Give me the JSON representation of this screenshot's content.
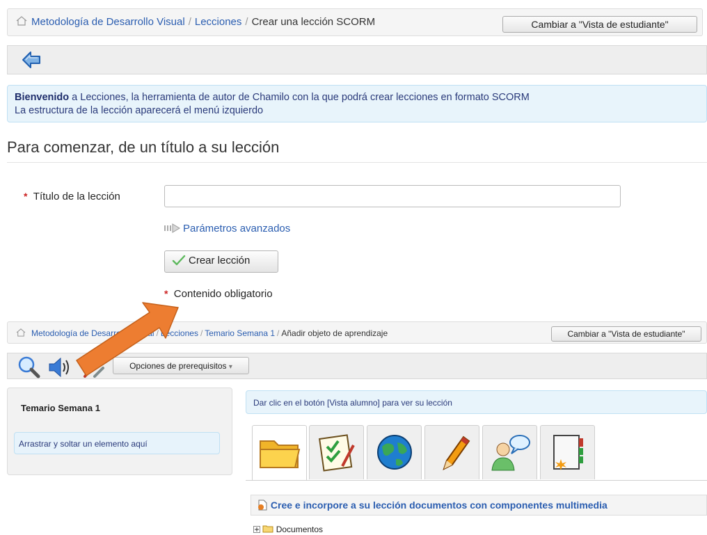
{
  "top": {
    "breadcrumb": [
      "Metodología de Desarrollo Visual",
      "Lecciones",
      "Crear una lección SCORM"
    ],
    "switch_view_label": "Cambiar a \"Vista de estudiante\""
  },
  "welcome": {
    "bold": "Bienvenido",
    "line1_rest": " a Lecciones, la herramienta de autor de Chamilo con la que podrá crear lecciones en formato SCORM",
    "line2": "La estructura de la lección aparecerá el menú izquierdo"
  },
  "form": {
    "heading": "Para comenzar, de un título a su lección",
    "required_mark": "*",
    "title_label": "Título de la lección",
    "title_value": "",
    "advanced_label": "Parámetros avanzados",
    "create_label": "Crear lección",
    "required_note": "Contenido obligatorio"
  },
  "bottom": {
    "breadcrumb": [
      "Metodología de Desarrollo Visual",
      "Lecciones",
      "Temario Semana 1",
      "Añadir objeto de aprendizaje"
    ],
    "switch_view_label": "Cambiar a \"Vista de estudiante\"",
    "prereq_label": "Opciones de prerequisitos",
    "sidebar_title": "Temario Semana 1",
    "drop_zone": "Arrastrar y soltar un elemento aquí",
    "info": "Dar clic en el botón [Vista alumno] para ver su lección",
    "tab_icons": [
      "folder-icon",
      "checklist-icon",
      "globe-icon",
      "pencil-icon",
      "chat-users-icon",
      "notebook-icon"
    ],
    "section_title": "Cree e incorpore a su lección documentos con componentes multimedia",
    "tree_item": "Documentos"
  },
  "colors": {
    "link": "#2a5db0",
    "info_bg": "#e8f4fb",
    "arrow": "#ed7d31"
  }
}
